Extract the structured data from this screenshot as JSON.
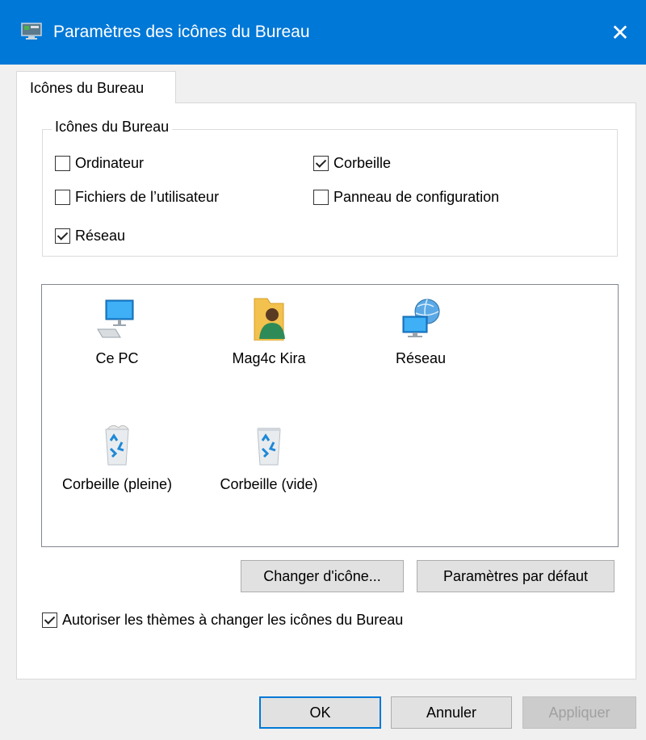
{
  "window": {
    "title": "Paramètres des icônes du Bureau",
    "close_glyph": "✕",
    "accent": "#0078d7"
  },
  "tab": {
    "label": "Icônes du Bureau"
  },
  "group": {
    "legend": "Icônes du Bureau",
    "checkboxes": [
      {
        "label": "Ordinateur",
        "checked": false
      },
      {
        "label": "Corbeille",
        "checked": true
      },
      {
        "label": "Fichiers de l’utilisateur",
        "checked": false
      },
      {
        "label": "Panneau de configuration",
        "checked": false
      },
      {
        "label": "Réseau",
        "checked": true
      }
    ]
  },
  "icons": [
    {
      "label": "Ce PC",
      "icon": "computer-icon",
      "selected": false
    },
    {
      "label": "Mag4c Kira",
      "icon": "user-folder-icon",
      "selected": false
    },
    {
      "label": "Réseau",
      "icon": "network-icon",
      "selected": false
    },
    {
      "label": "Corbeille (pleine)",
      "icon": "recycle-bin-full-icon",
      "selected": false
    },
    {
      "label": "Corbeille (vide)",
      "icon": "recycle-bin-empty-icon",
      "selected": false
    }
  ],
  "buttons": {
    "change_icon": "Changer d'icône...",
    "defaults": "Paramètres par défaut",
    "ok": "OK",
    "cancel": "Annuler",
    "apply": "Appliquer"
  },
  "themes_checkbox": {
    "label": "Autoriser les thèmes à changer les icônes du Bureau",
    "checked": true
  }
}
